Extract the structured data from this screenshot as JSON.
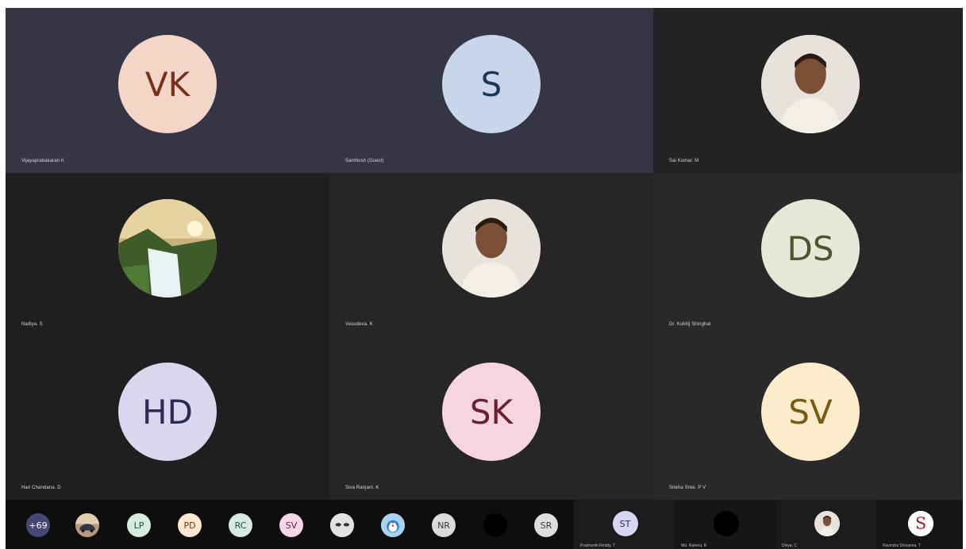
{
  "tiles": [
    {
      "name": "Vijayaprabakaran K",
      "initials": "VK",
      "photo": false,
      "avatar_bg": "#f4d6c8",
      "avatar_fg": "#7a2f1c",
      "tile_bg": "#363546"
    },
    {
      "name": "Santhosh (Guest)",
      "initials": "S",
      "photo": false,
      "avatar_bg": "#c8d6ec",
      "avatar_fg": "#1f3657",
      "tile_bg": "#363546"
    },
    {
      "name": "Sai Kumar. M",
      "initials": "",
      "photo": true,
      "photo_icon": "person-photo-icon",
      "avatar_bg": "#f2f2f2",
      "avatar_fg": "#000000",
      "tile_bg": "#232323"
    },
    {
      "name": "Nadiya. S",
      "initials": "",
      "photo": true,
      "photo_icon": "waterfall-landscape-icon",
      "avatar_bg": "#6b8a4a",
      "avatar_fg": "#000000",
      "tile_bg": "#1f1f1f"
    },
    {
      "name": "Vasudeva. K",
      "initials": "",
      "photo": true,
      "photo_icon": "person-photo-icon",
      "avatar_bg": "#8a6a52",
      "avatar_fg": "#000000",
      "tile_bg": "#262626"
    },
    {
      "name": "Dr. Kshitij Shinghal",
      "initials": "DS",
      "photo": false,
      "avatar_bg": "#e5e9d6",
      "avatar_fg": "#4b5631",
      "tile_bg": "#292929"
    },
    {
      "name": "Hari Chandana. D",
      "initials": "HD",
      "photo": false,
      "avatar_bg": "#d9d6ee",
      "avatar_fg": "#2c2b55",
      "tile_bg": "#1f1f1f"
    },
    {
      "name": "Siva Ranjani. K",
      "initials": "SK",
      "photo": false,
      "avatar_bg": "#f6d6de",
      "avatar_fg": "#6a1f32",
      "tile_bg": "#262626"
    },
    {
      "name": "Sneha Sree. P V",
      "initials": "SV",
      "photo": false,
      "avatar_bg": "#fdeccb",
      "avatar_fg": "#7a5a10",
      "tile_bg": "#292929"
    }
  ],
  "overflow": {
    "label": "+69",
    "bg": "#464775",
    "fg": "#ffffff"
  },
  "strip_avatars": [
    {
      "label": "",
      "icon": "car-photo-icon",
      "bg": "#7a6a5a",
      "fg": "#ffffff"
    },
    {
      "label": "LP",
      "bg": "#d6ecdc",
      "fg": "#1f4a2f"
    },
    {
      "label": "PD",
      "bg": "#fde8cf",
      "fg": "#6a3a10"
    },
    {
      "label": "RC",
      "bg": "#d6e9e5",
      "fg": "#1f4a44"
    },
    {
      "label": "SV",
      "bg": "#f6d6e6",
      "fg": "#6a1f44"
    },
    {
      "label": "",
      "icon": "eyes-photo-icon",
      "bg": "#d8d8d8",
      "fg": "#000000"
    },
    {
      "label": "",
      "icon": "cartoon-photo-icon",
      "bg": "#9ec6e6",
      "fg": "#000000"
    },
    {
      "label": "NR",
      "bg": "#dcdcdc",
      "fg": "#3a3a3a"
    },
    {
      "label": "",
      "icon": "blank-avatar-icon",
      "bg": "#1c1c1c",
      "fg": "#ffffff"
    },
    {
      "label": "SR",
      "bg": "#dedede",
      "fg": "#3a3a3a"
    }
  ],
  "strip_tiles": [
    {
      "label": "ST",
      "name": "Prashanth Reddy. T",
      "bg": "#d6d6f0",
      "fg": "#2c2b55",
      "tile_bg": "#1c1c1c"
    },
    {
      "label": "",
      "name": "Md. Rafeeq. R",
      "icon": "blank-avatar-icon",
      "bg": "#000000",
      "fg": "#ffffff",
      "tile_bg": "#161616"
    },
    {
      "label": "",
      "name": "Divya. C",
      "icon": "person-photo-icon",
      "bg": "#6b7fa8",
      "fg": "#ffffff",
      "tile_bg": "#1c1c1c"
    },
    {
      "label": "S",
      "name": "Ravindra Shivanna. T",
      "icon": "s-logo-icon",
      "bg": "#ffffff",
      "fg": "#a01a2a",
      "tile_bg": "#161616"
    }
  ]
}
